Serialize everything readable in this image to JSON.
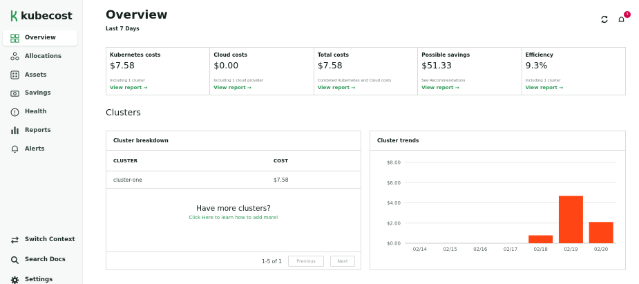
{
  "brand": {
    "name": "kubecost",
    "color": "#2e9b57"
  },
  "sidebar": {
    "items": [
      {
        "label": "Overview",
        "icon": "grid-icon",
        "active": true
      },
      {
        "label": "Allocations",
        "icon": "allocations-icon",
        "active": false
      },
      {
        "label": "Assets",
        "icon": "assets-icon",
        "active": false
      },
      {
        "label": "Savings",
        "icon": "savings-icon",
        "active": false
      },
      {
        "label": "Health",
        "icon": "health-icon",
        "active": false
      },
      {
        "label": "Reports",
        "icon": "reports-icon",
        "active": false
      },
      {
        "label": "Alerts",
        "icon": "bell-icon",
        "active": false
      }
    ],
    "bottom": [
      {
        "label": "Switch Context",
        "icon": "switch-icon"
      },
      {
        "label": "Search Docs",
        "icon": "search-icon"
      },
      {
        "label": "Settings",
        "icon": "gear-icon"
      }
    ]
  },
  "header": {
    "title": "Overview",
    "subtitle": "Last 7 Days",
    "notification_count": "3"
  },
  "kpis": [
    {
      "title": "Kubernetes costs",
      "value": "$7.58",
      "note": "Including 1 cluster",
      "link": "View report →"
    },
    {
      "title": "Cloud costs",
      "value": "$0.00",
      "note": "Including 1 cloud provider",
      "link": "View report →"
    },
    {
      "title": "Total costs",
      "value": "$7.58",
      "note": "Combined Kubernetes and Cloud costs",
      "link": "View report →"
    },
    {
      "title": "Possible savings",
      "value": "$51.33",
      "note": "See Recommendations",
      "link": "View report →"
    },
    {
      "title": "Efficiency",
      "value": "9.3%",
      "note": "Including 1 cluster",
      "link": "View report →"
    }
  ],
  "clusters": {
    "section_title": "Clusters",
    "breakdown": {
      "title": "Cluster breakdown",
      "columns": [
        "CLUSTER",
        "COST"
      ],
      "rows": [
        {
          "cluster": "cluster-one",
          "cost": "$7.58"
        }
      ],
      "more_title": "Have more clusters?",
      "more_link": "Click Here to learn how to add more!",
      "pager_count": "1-5 of 1",
      "prev_label": "Previous",
      "next_label": "Next"
    },
    "trends": {
      "title": "Cluster trends"
    }
  },
  "chart_data": {
    "type": "bar",
    "categories": [
      "02/14",
      "02/15",
      "02/16",
      "02/17",
      "02/18",
      "02/19",
      "02/20"
    ],
    "values": [
      0,
      0,
      0,
      0,
      0.78,
      4.68,
      2.1
    ],
    "ylim": [
      0,
      8
    ],
    "yticks": [
      "$0.00",
      "$2.00",
      "$4.00",
      "$6.00",
      "$8.00"
    ],
    "bar_color": "#ff4513",
    "grid": true
  }
}
